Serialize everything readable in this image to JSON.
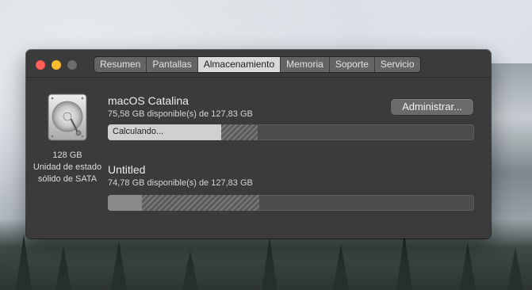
{
  "window": {
    "tabs": [
      {
        "label": "Resumen",
        "active": false
      },
      {
        "label": "Pantallas",
        "active": false
      },
      {
        "label": "Almacenamiento",
        "active": true
      },
      {
        "label": "Memoria",
        "active": false
      },
      {
        "label": "Soporte",
        "active": false
      },
      {
        "label": "Servicio",
        "active": false
      }
    ]
  },
  "disk": {
    "icon": "internal-drive-icon",
    "size": "128 GB",
    "type_line1": "Unidad de estado",
    "type_line2": "sólido de SATA"
  },
  "volumes": [
    {
      "name": "macOS Catalina",
      "available": "75,58 GB disponible(s) de 127,83 GB",
      "bar_status": "Calculando...",
      "used_fraction": 0.31,
      "pending_fraction": 0.1
    },
    {
      "name": "Untitled",
      "available": "74,78 GB disponible(s) de 127,83 GB",
      "used_fraction": 0.094,
      "pending_fraction": 0.32
    }
  ],
  "actions": {
    "manage_label": "Administrar..."
  },
  "colors": {
    "close": "#fe5f57",
    "minimize": "#febc2e",
    "window_bg": "#3b3b3c"
  }
}
